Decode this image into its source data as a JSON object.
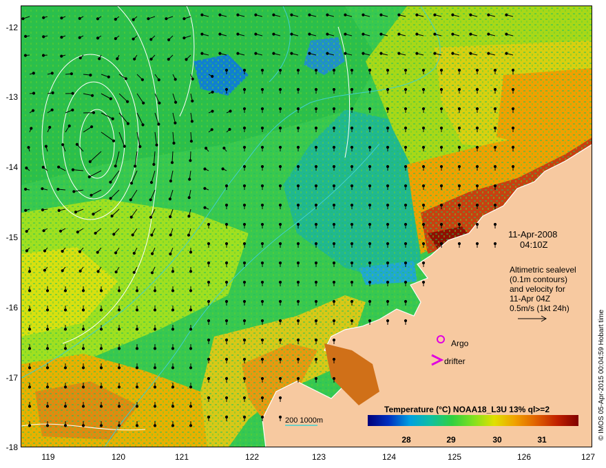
{
  "map": {
    "y_ticks": [
      "-12",
      "-13",
      "-14",
      "-15",
      "-16",
      "-17",
      "-18"
    ],
    "x_ticks": [
      "119",
      "120",
      "121",
      "122",
      "123",
      "124",
      "125",
      "126",
      "127"
    ],
    "lon_range": [
      118.6,
      127
    ],
    "lat_range": [
      -18,
      -11.8
    ],
    "land_color": "#f7c9a0",
    "contour_color": "#ffffff",
    "isobath_color": "#40d0d0"
  },
  "annotations": {
    "date": "11-Apr-2008",
    "time": "04:10Z",
    "altimetry_lines": [
      "Altimetric sealevel",
      "(0.1m contours)",
      "and velocity for",
      "11-Apr 04Z",
      "0.5m/s (1kt 24h)"
    ],
    "argo": "Argo",
    "drifter": "drifter",
    "depth": "200  1000m"
  },
  "colorbar": {
    "title": "Temperature (°C) NOAA18_L3U 13% ql>=2",
    "ticks": [
      "28",
      "29",
      "30",
      "31"
    ],
    "colors": [
      "#00007a",
      "#0030c0",
      "#00a0e0",
      "#10c0a0",
      "#30d040",
      "#80e020",
      "#e0e000",
      "#f0a000",
      "#e06000",
      "#c02000",
      "#800000"
    ]
  },
  "credit": "© IMOS 05-Apr-2015 00:04:59 Hobart time"
}
